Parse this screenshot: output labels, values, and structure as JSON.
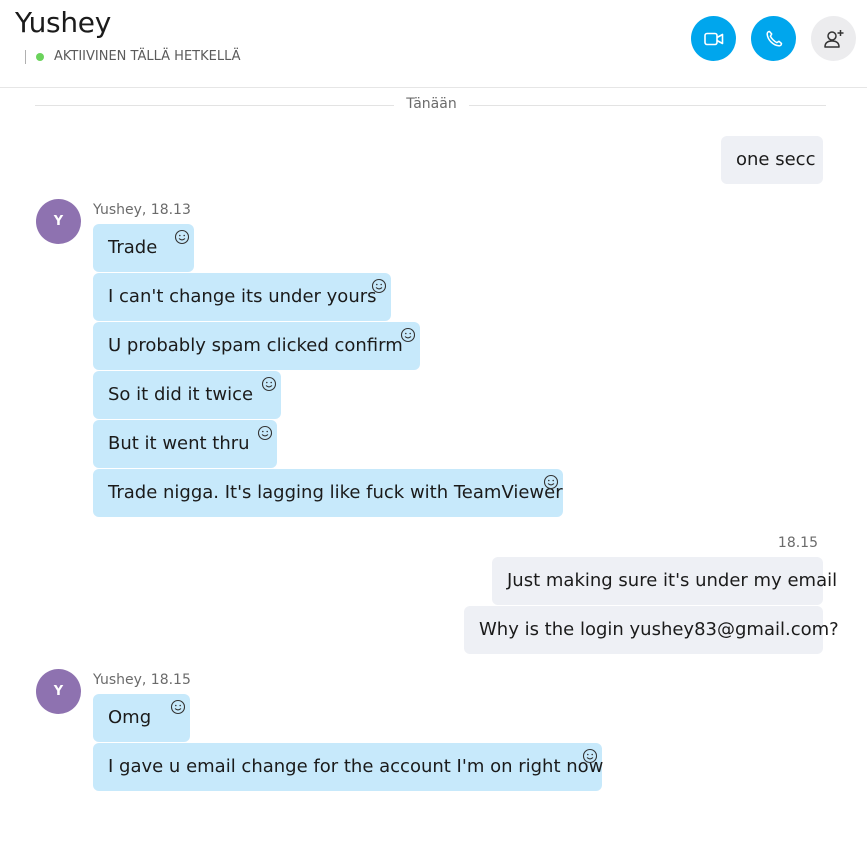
{
  "header": {
    "title": "Yushey",
    "status": "AKTIIVINEN TÄLLÄ HETKELLÄ",
    "video_icon": "video-camera-icon",
    "call_icon": "phone-icon",
    "add_icon": "add-person-icon"
  },
  "colors": {
    "accent": "#00a6ed",
    "online": "#6bd35c",
    "incoming_bubble": "#c7e9fb",
    "outgoing_bubble": "#eef0f5",
    "avatar": "#8e72b0"
  },
  "divider": {
    "label": "Tänään"
  },
  "messages": {
    "out1": {
      "text": "one secc"
    },
    "group1": {
      "avatar_initial": "Y",
      "meta": "Yushey, 18.13",
      "items": [
        {
          "text": "Trade"
        },
        {
          "text": "I can't change its under yours"
        },
        {
          "text": "U probably spam clicked confirm"
        },
        {
          "text": "So it did it twice"
        },
        {
          "text": "But it went thru"
        },
        {
          "text": "Trade nigga. It's lagging like fuck with TeamViewer"
        }
      ]
    },
    "out2": {
      "time": "18.15",
      "items": [
        {
          "text": "Just making sure it's under my email"
        },
        {
          "text": "Why is the login yushey83@gmail.com?"
        }
      ]
    },
    "group2": {
      "avatar_initial": "Y",
      "meta": "Yushey, 18.15",
      "items": [
        {
          "text": "Omg"
        },
        {
          "text": "I gave u email change for the account I'm on right now"
        }
      ]
    }
  }
}
